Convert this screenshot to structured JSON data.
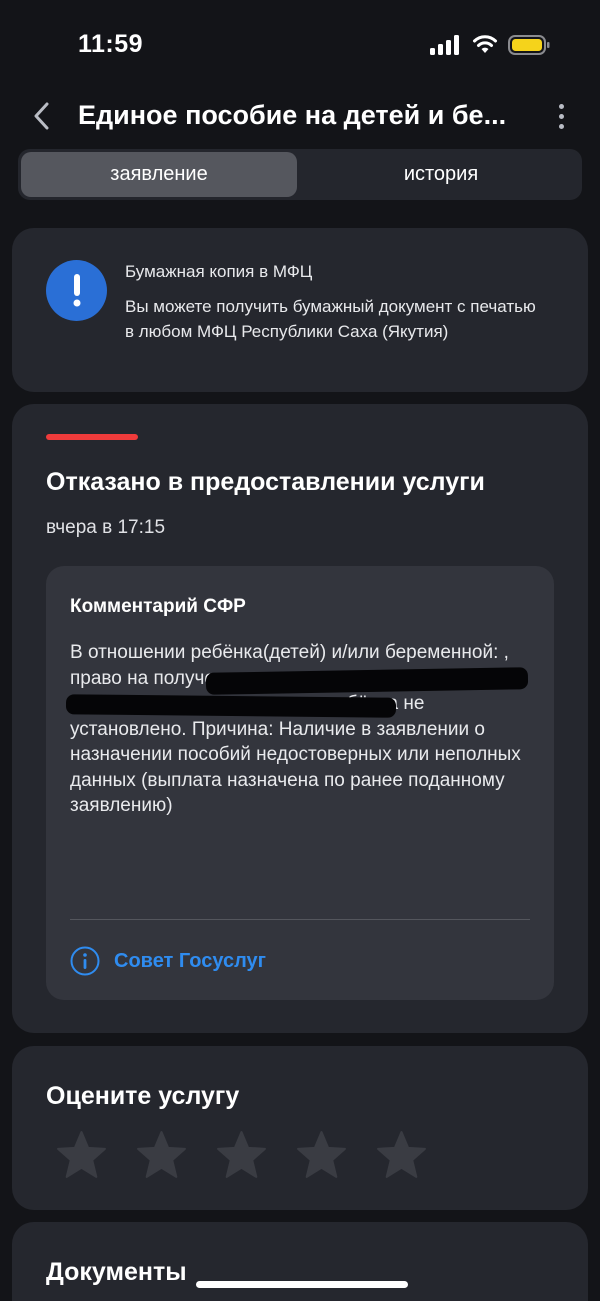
{
  "status_bar": {
    "time": "11:59"
  },
  "nav": {
    "title": "Единое пособие на детей и бе..."
  },
  "tabs": [
    {
      "label": "заявление",
      "active": true
    },
    {
      "label": "история",
      "active": false
    }
  ],
  "info_card": {
    "icon": "exclamation-icon",
    "title": "Бумажная копия в МФЦ",
    "text": "Вы можете получить бумажный документ с печатью в любом МФЦ Республики Саха (Якутия)"
  },
  "status_card": {
    "status_color": "#ef3b3b",
    "title": "Отказано в предоставлении услуги",
    "date": "вчера в 17:15",
    "comment": {
      "title": "Комментарий СФР",
      "text": "В отношении ребёнка(детей) и/или беременной: , право на получение ежемесячного пособия в связи с рождением и воспитанием ребёнка не установлено. Причина: Наличие в заявлении о назначении пособий недостоверных или неполных данных (выплата назначена по ранее поданному заявлению)",
      "advice_link": "Совет Госуслуг"
    }
  },
  "rating_card": {
    "title": "Оцените услугу",
    "stars_total": 5,
    "stars_selected": 0
  },
  "documents_card": {
    "title": "Документы"
  },
  "colors": {
    "background": "#131418",
    "card": "#25272e",
    "accent_blue": "#2f8cf0",
    "danger": "#ef3b3b"
  }
}
